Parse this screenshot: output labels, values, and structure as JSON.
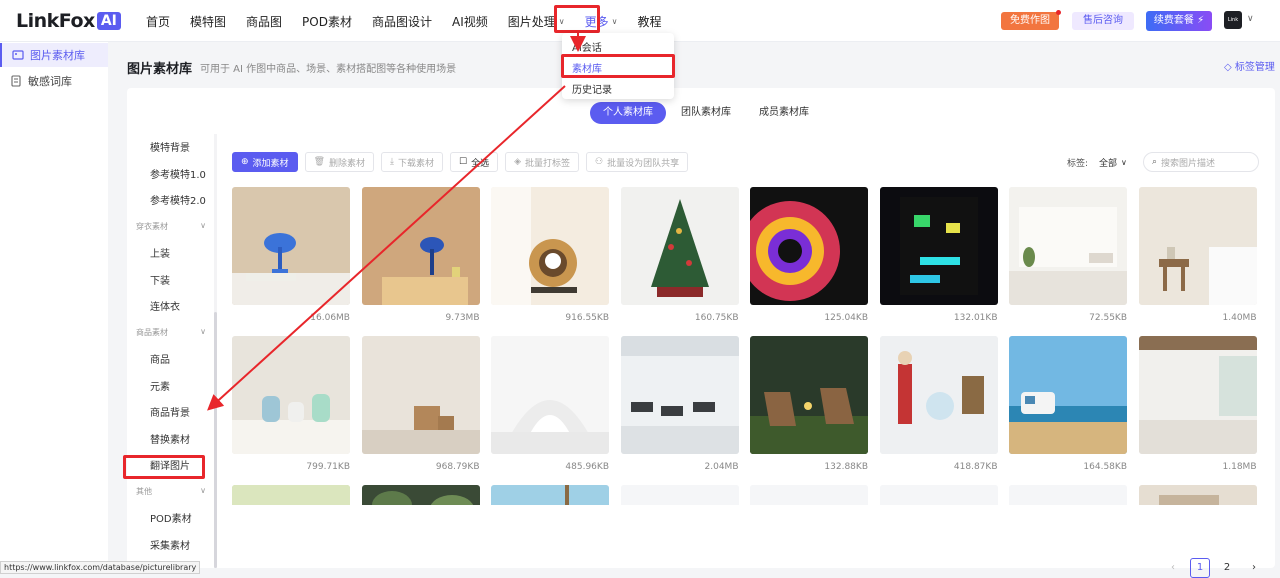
{
  "topbar": {
    "logo_text": "LinkFox",
    "logo_badge": "AI",
    "nav": [
      "首页",
      "模特图",
      "商品图",
      "POD素材",
      "商品图设计",
      "AI视频",
      "图片处理",
      "更多",
      "教程"
    ],
    "free_btn": "免费作图",
    "support_btn": "售后咨询",
    "renew_btn": "续费套餐 ⚡",
    "avatar_text": "Link Fox"
  },
  "dropdown": {
    "items": [
      "AI会话",
      "素材库",
      "历史记录"
    ]
  },
  "sidebar": {
    "items": [
      "图片素材库",
      "敏感词库"
    ]
  },
  "page": {
    "title": "图片素材库",
    "subtitle": "可用于 AI 作图中商品、场景、素材搭配图等各种使用场景",
    "tag_mgmt": "标签管理"
  },
  "tabs": [
    "个人素材库",
    "团队素材库",
    "成员素材库"
  ],
  "categories": {
    "items": [
      {
        "label": "模特背景",
        "type": "item"
      },
      {
        "label": "参考模特1.0",
        "type": "item"
      },
      {
        "label": "参考模特2.0",
        "type": "item"
      },
      {
        "label": "穿衣素材",
        "type": "group"
      },
      {
        "label": "上装",
        "type": "item"
      },
      {
        "label": "下装",
        "type": "item"
      },
      {
        "label": "连体衣",
        "type": "item"
      },
      {
        "label": "商品素材",
        "type": "group"
      },
      {
        "label": "商品",
        "type": "item"
      },
      {
        "label": "元素",
        "type": "item"
      },
      {
        "label": "商品背景",
        "type": "item"
      },
      {
        "label": "替换素材",
        "type": "item"
      },
      {
        "label": "翻译图片",
        "type": "item"
      },
      {
        "label": "其他",
        "type": "group"
      },
      {
        "label": "POD素材",
        "type": "item"
      },
      {
        "label": "采集素材",
        "type": "item"
      }
    ]
  },
  "toolbar": {
    "add": "添加素材",
    "delete": "删除素材",
    "download": "下载素材",
    "select_all": "全选",
    "batch_tag": "批量打标签",
    "batch_share": "批量设为团队共享",
    "filter_label": "标签:",
    "filter_value": "全部",
    "search_placeholder": "搜索图片描述"
  },
  "images": [
    {
      "size": "16.06MB",
      "scene": "lamp-books"
    },
    {
      "size": "9.73MB",
      "scene": "lamp-table"
    },
    {
      "size": "916.55KB",
      "scene": "cat-bed"
    },
    {
      "size": "160.75KB",
      "scene": "xmas-tree"
    },
    {
      "size": "125.04KB",
      "scene": "gradient"
    },
    {
      "size": "132.01KB",
      "scene": "neon-tunnel"
    },
    {
      "size": "72.55KB",
      "scene": "white-room"
    },
    {
      "size": "1.40MB",
      "scene": "bedroom"
    },
    {
      "size": "799.71KB",
      "scene": "kettles"
    },
    {
      "size": "968.79KB",
      "scene": "box-wall"
    },
    {
      "size": "485.96KB",
      "scene": "white-arch"
    },
    {
      "size": "2.04MB",
      "scene": "gym"
    },
    {
      "size": "132.88KB",
      "scene": "camp-chairs"
    },
    {
      "size": "418.87KB",
      "scene": "nutcracker"
    },
    {
      "size": "164.58KB",
      "scene": "beach-van"
    },
    {
      "size": "1.18MB",
      "scene": "empty-hall"
    },
    {
      "size": "",
      "scene": "green"
    },
    {
      "size": "",
      "scene": "plants"
    },
    {
      "size": "",
      "scene": "sky-palm"
    },
    {
      "size": "",
      "scene": "blank"
    },
    {
      "size": "",
      "scene": "blank"
    },
    {
      "size": "",
      "scene": "blank"
    },
    {
      "size": "",
      "scene": "blank"
    },
    {
      "size": "",
      "scene": "window"
    }
  ],
  "pagination": {
    "prev": "‹",
    "pages": [
      "1",
      "2"
    ],
    "next": "›"
  },
  "status_url": "https://www.linkfox.com/database/picturelibrary",
  "colors": {
    "accent": "#5b5cf0",
    "annotation": "#e8262b",
    "free": "#f2753f"
  }
}
